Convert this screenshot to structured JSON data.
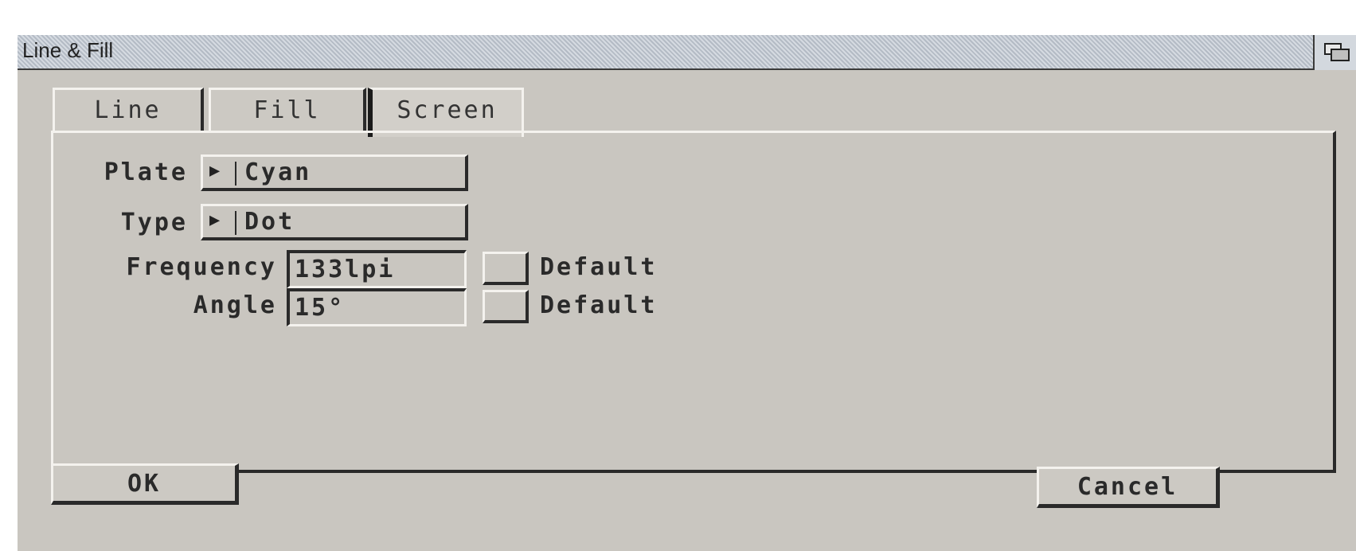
{
  "window": {
    "title": "Line & Fill"
  },
  "tabs": [
    {
      "label": "Line",
      "active": false
    },
    {
      "label": "Fill",
      "active": false
    },
    {
      "label": "Screen",
      "active": true
    }
  ],
  "screen": {
    "plate": {
      "label": "Plate",
      "value": "Cyan"
    },
    "type": {
      "label": "Type",
      "value": "Dot"
    },
    "frequency": {
      "label": "Frequency",
      "value": "133lpi",
      "default_label": "Default",
      "default_checked": false
    },
    "angle": {
      "label": "Angle",
      "value": "15°",
      "default_label": "Default",
      "default_checked": false
    }
  },
  "buttons": {
    "ok": "OK",
    "cancel": "Cancel"
  },
  "icons": {
    "cycle": "cycle-arrow-icon",
    "depth": "window-depth-icon"
  },
  "colors": {
    "background": "#c9c6c0",
    "titlebar": "#bfc7d1",
    "shadow": "#2a2a2a",
    "highlight": "#f4f2ee"
  }
}
